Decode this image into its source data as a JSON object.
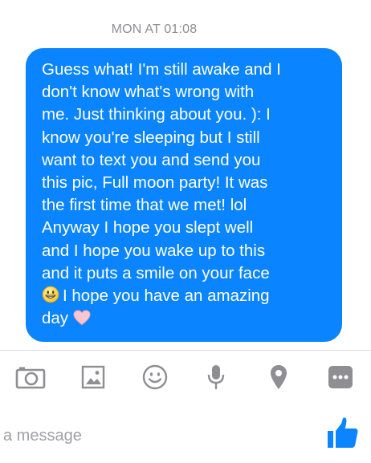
{
  "thread": {
    "timestamp": "MON AT 01:08"
  },
  "message": {
    "lines": [
      "Guess what! I'm still awake and I",
      "don't know what's wrong with",
      "me. Just thinking about you. ): I",
      "know you're sleeping but I still",
      "want to text you and send you",
      "this pic, Full moon party! It was",
      "the first time that we met! lol",
      "Anyway I hope you slept well",
      "and I hope you wake up to this",
      "and it puts a smile on your face",
      "I hope you have an amazing",
      "day"
    ],
    "emoji_line_11": "grinning-face-emoji",
    "emoji_line_12": "heart-emoji"
  },
  "toolbar": {
    "icons": [
      "camera-icon",
      "photo-icon",
      "emoji-icon",
      "microphone-icon",
      "location-icon",
      "more-icon"
    ]
  },
  "composer": {
    "placeholder": "a message",
    "value": "",
    "send_icon": "thumbs-up-icon"
  },
  "colors": {
    "bubble": "#0a84ff",
    "bubble_text": "#ffffff",
    "timestamp": "#8e8e93",
    "toolbar_icons": "#8e8e93",
    "like_button": "#0a84ff",
    "placeholder": "#a0a0a5"
  }
}
